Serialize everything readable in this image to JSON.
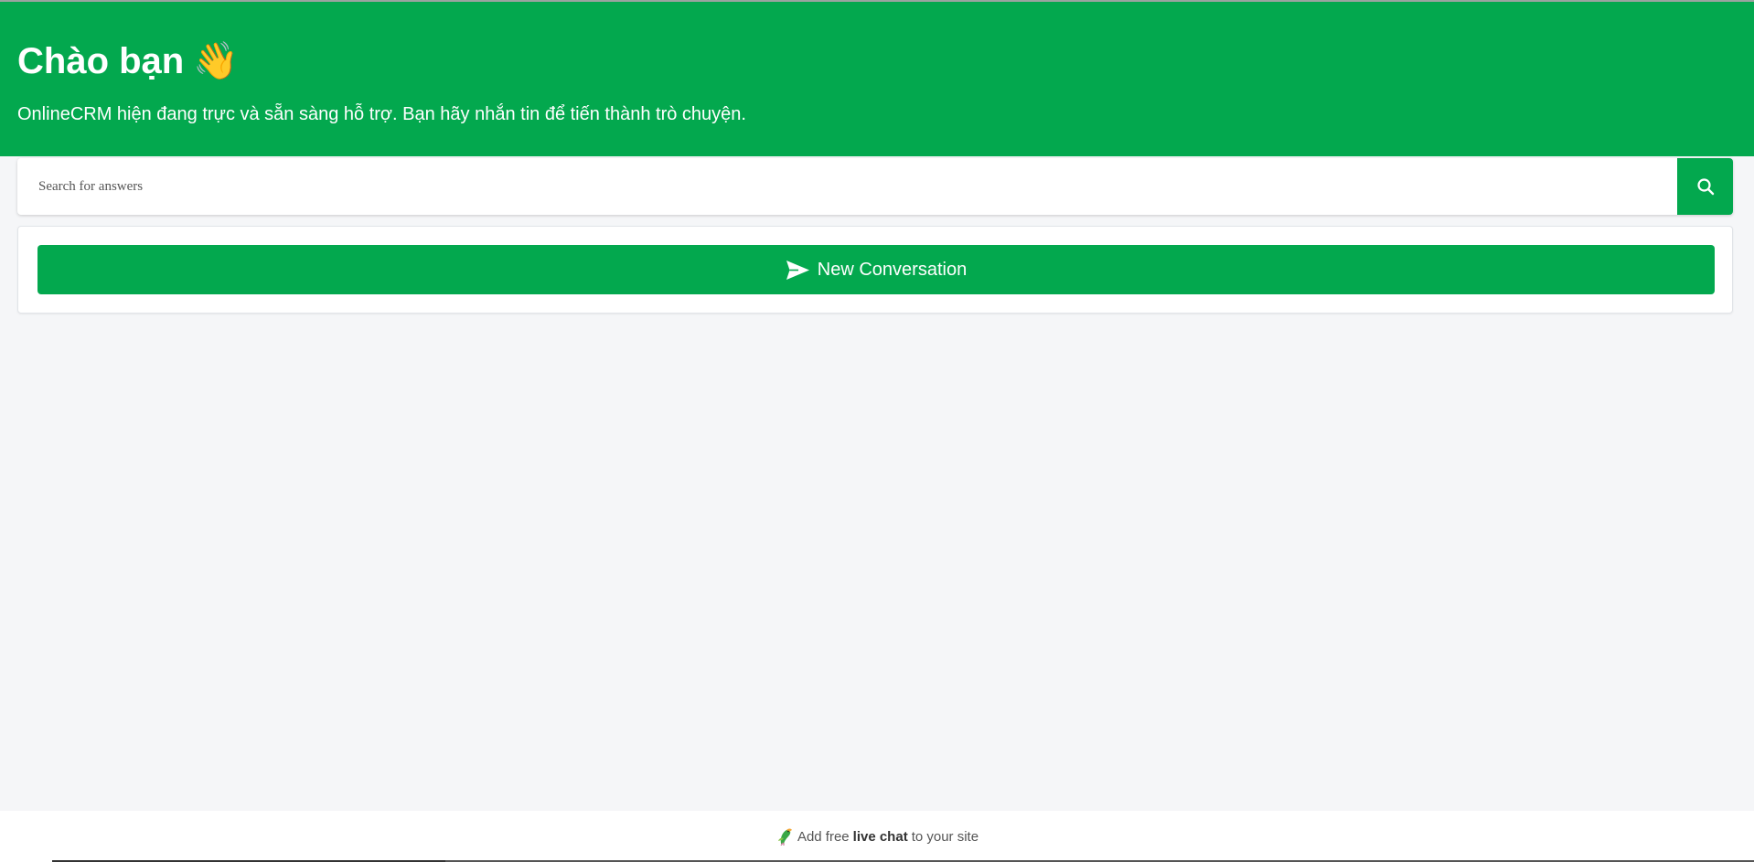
{
  "header": {
    "title": "Chào bạn",
    "wave_emoji": "👋",
    "subtitle": "OnlineCRM hiện đang trực và sẵn sàng hỗ trợ. Bạn hãy nhắn tin để tiến thành trò chuyện."
  },
  "search": {
    "placeholder": "Search for answers",
    "value": "",
    "button_icon": "search-icon"
  },
  "actions": {
    "new_conversation_label": "New Conversation",
    "new_conversation_icon": "send-icon"
  },
  "footer": {
    "prefix": "Add free",
    "bold": "live chat",
    "suffix": "to your site",
    "icon": "bird-logo-icon"
  },
  "colors": {
    "brand_green": "#03a84e",
    "page_background": "#f5f6f8"
  }
}
